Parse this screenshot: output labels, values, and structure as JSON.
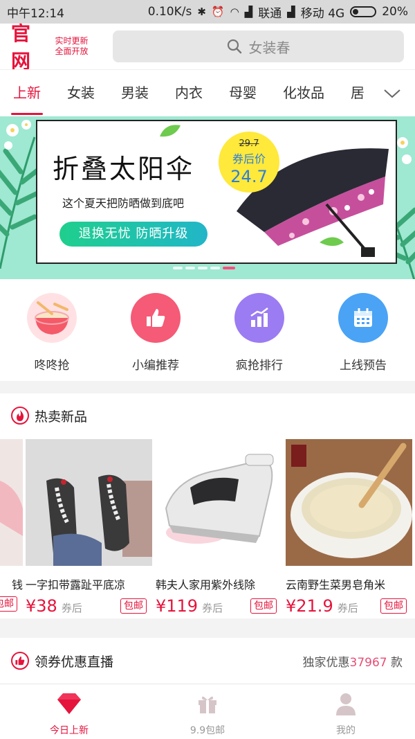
{
  "status_bar": {
    "time": "中午12:14",
    "net_speed": "0.10K/s",
    "carrier1": "联通",
    "carrier2": "移动 4G",
    "battery": "20%"
  },
  "header": {
    "logo": "官网",
    "tagline_line1": "实时更新",
    "tagline_line2": "全面开放",
    "search_placeholder": "女装春"
  },
  "tabs": [
    "上新",
    "女装",
    "男装",
    "内衣",
    "母婴",
    "化妆品",
    "居"
  ],
  "banner": {
    "title": "折叠太阳伞",
    "subtitle": "这个夏天把防晒做到底吧",
    "button": "退换无忧 防晒升级",
    "old_price": "29.7",
    "price_label": "券后价",
    "price": "24.7"
  },
  "quick_entries": [
    {
      "label": "咚咚抢",
      "icon": "drum-icon"
    },
    {
      "label": "小编推荐",
      "icon": "thumbs-up-icon"
    },
    {
      "label": "疯抢排行",
      "icon": "ranking-chart-icon"
    },
    {
      "label": "上线预告",
      "icon": "calendar-icon"
    }
  ],
  "hot_section": {
    "title": "热卖新品",
    "products": [
      {
        "title": "钱",
        "price": "",
        "coupon": "",
        "tag": "包邮"
      },
      {
        "title": "一字扣带露趾平底凉",
        "price": "¥38",
        "coupon": "券后",
        "tag": "包邮"
      },
      {
        "title": "韩夫人家用紫外线除",
        "price": "¥119",
        "coupon": "券后",
        "tag": "包邮"
      },
      {
        "title": "云南野生菜男皂角米",
        "price": "¥21.9",
        "coupon": "券后",
        "tag": "包邮"
      }
    ]
  },
  "coupon_section": {
    "title": "领券优惠直播",
    "exclusive_prefix": "独家优惠",
    "exclusive_count": "37967",
    "exclusive_suffix": "款"
  },
  "bottom_nav": [
    {
      "label": "今日上新",
      "icon": "diamond-icon",
      "active": true
    },
    {
      "label": "9.9包邮",
      "icon": "gift-icon",
      "active": false
    },
    {
      "label": "我的",
      "icon": "user-icon",
      "active": false
    }
  ],
  "colors": {
    "accent": "#e5143c",
    "banner_bg": "#9fe8d2",
    "badge_yellow": "#ffe93a",
    "highlight_pink": "#e84d73"
  }
}
